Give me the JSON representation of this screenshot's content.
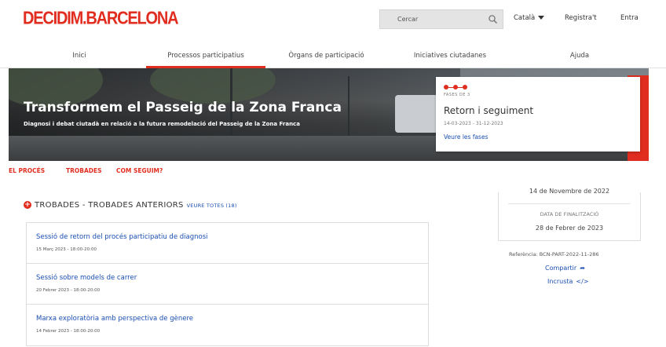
{
  "header": {
    "logo": "DECIDIM.BARCELONA",
    "search_placeholder": "Cercar",
    "language": "Català",
    "register": "Registra't",
    "login": "Entra"
  },
  "nav": {
    "items": [
      {
        "label": "Inici",
        "active": false
      },
      {
        "label": "Processos participatius",
        "active": true
      },
      {
        "label": "Òrgans de participació",
        "active": false
      },
      {
        "label": "Iniciatives ciutadanes",
        "active": false
      },
      {
        "label": "Ajuda",
        "active": false
      }
    ]
  },
  "hero": {
    "title": "Transformem el Passeig de la Zona Franca",
    "subtitle": "Diagnosi i debat ciutadà en relació a la futura remodelació del Passeig de la Zona Franca",
    "phase_label": "FASES DE 3",
    "phase_title": "Retorn i seguiment",
    "phase_dates": "14-03-2023 - 31-12-2023",
    "phase_link": "Veure les fases"
  },
  "subnav": {
    "items": [
      "EL PROCÉS",
      "TROBADES",
      "COM SEGUIM?"
    ]
  },
  "findings": {
    "title": "TROBADES - TROBADES ANTERIORS",
    "see_all": "VEURE TOTES (18)",
    "meetings": [
      {
        "title": "Sessió de retorn del procés participatiu de diagnosi",
        "date": "15 Març 2023 - 18:00-20:00"
      },
      {
        "title": "Sessió sobre models de carrer",
        "date": "20 Febrer 2023 - 18:00-20:00"
      },
      {
        "title": "Marxa exploratòria amb perspectiva de gènere",
        "date": "14 Febrer 2023 - 18:00-20:00"
      }
    ]
  },
  "sidebar": {
    "start_date": "14 de Novembre de 2022",
    "end_label": "DATA DE FINALITZACIÓ",
    "end_date": "28 de Febrer de 2023",
    "reference": "Referència: BCN-PART-2022-11-286",
    "share": "Compartir",
    "embed": "Incrusta"
  },
  "colors": {
    "accent": "#e02d1f",
    "link": "#1a4eb0"
  }
}
